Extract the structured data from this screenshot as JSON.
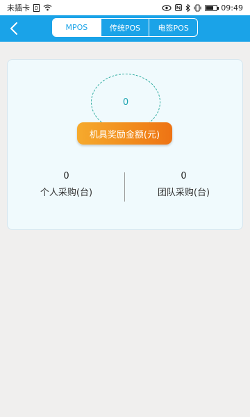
{
  "status_bar": {
    "carrier": "未插卡",
    "time": "09:49",
    "battery_level": 0.7
  },
  "header": {
    "back_icon": "chevron-left-icon",
    "tabs": [
      {
        "label": "MPOS",
        "active": true
      },
      {
        "label": "传统POS",
        "active": false
      },
      {
        "label": "电签POS",
        "active": false
      }
    ]
  },
  "card": {
    "reward_amount": "0",
    "reward_label": "机具奖励金额(元)",
    "personal": {
      "value": "0",
      "label": "个人采购(台)"
    },
    "team": {
      "value": "0",
      "label": "团队采购(台)"
    }
  },
  "colors": {
    "header_bg": "#1aa3e8",
    "page_bg": "#f0efee",
    "card_bg": "#f0fafd",
    "accent_orange": "#f18a1c",
    "circle_teal": "#2aaa9e"
  }
}
